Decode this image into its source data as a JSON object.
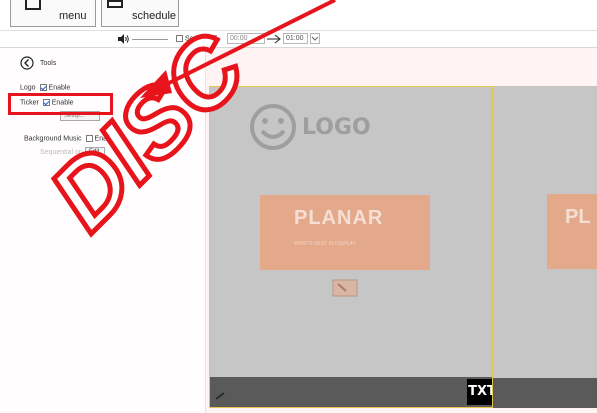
{
  "toolbar": {
    "menu_label": "menu",
    "schedule_label": "schedule"
  },
  "controls": {
    "screen_off_label": "Screen off",
    "start_time": "00:00",
    "end_time": "01:00"
  },
  "tools": {
    "title": "Tools",
    "logo_label": "Logo",
    "ticker_label": "Ticker",
    "enable_label": "Enable",
    "ticker_button_label": "Setup...",
    "background_music_label": "Background Music",
    "background_music_enable_label": "Enable",
    "loop_label": "Sequential on list",
    "edit_label": "Edit"
  },
  "preview": {
    "logo_text": "LOGO",
    "brand_text": "PLANAR",
    "brand_tagline": "WHAT'S NEXT IN DISPLAY",
    "brand_text_partial": "PL",
    "ticker_box_text": "TXT"
  },
  "overlay": {
    "watermark_text": "DISC",
    "highlight_color": "#e8141c"
  },
  "colors": {
    "screen_border": "#e3c84a",
    "banner": "#e4a98b",
    "panel_bg": "#fffdfd"
  }
}
